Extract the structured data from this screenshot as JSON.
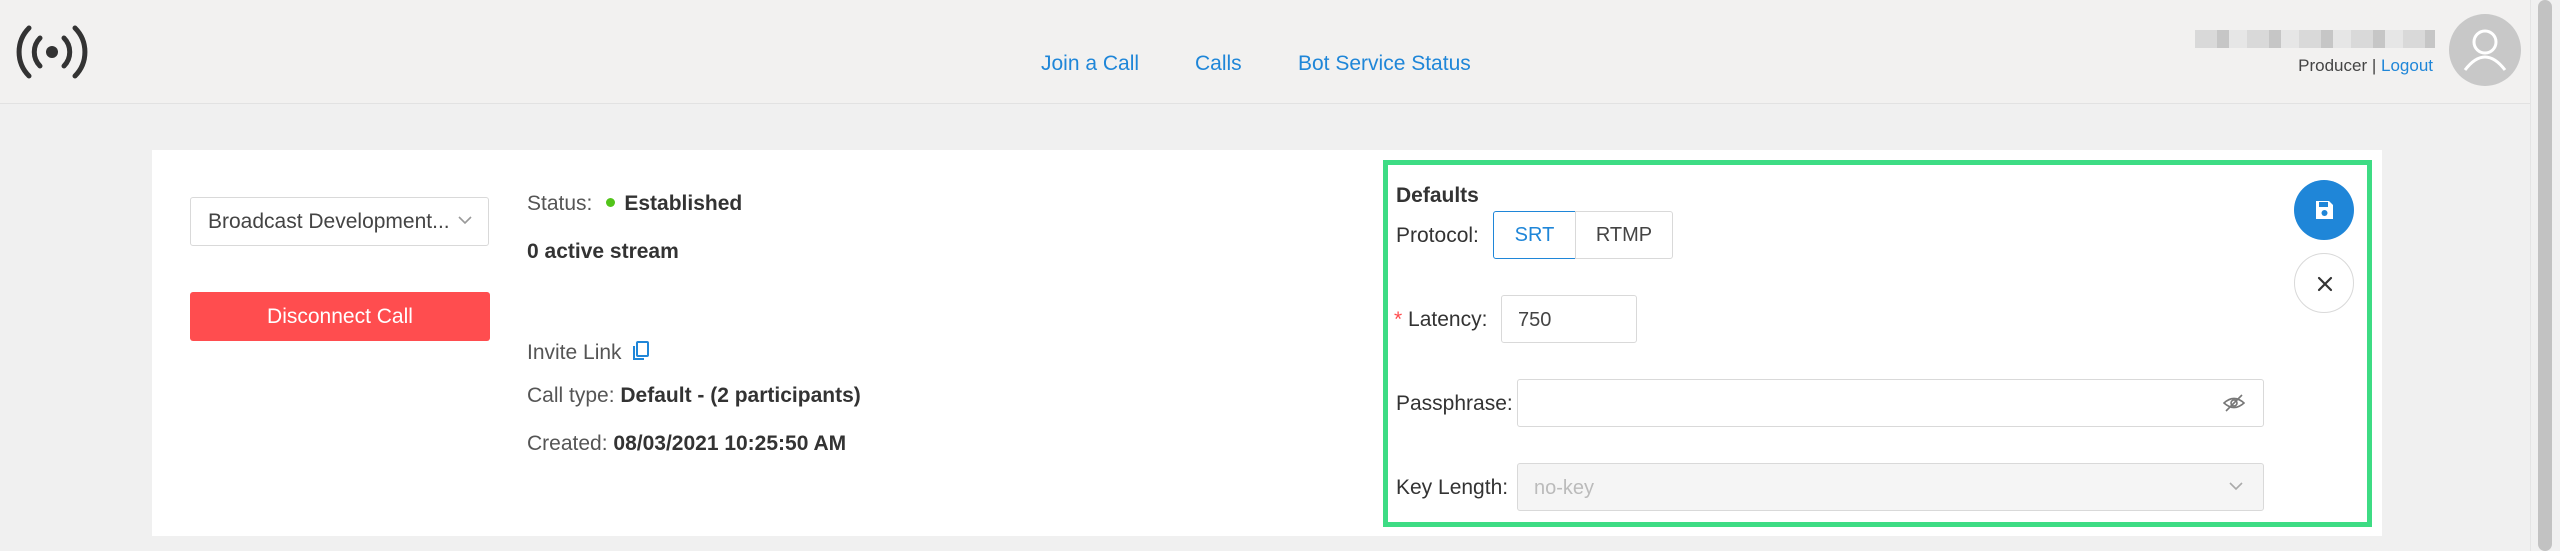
{
  "nav": {
    "join_call": "Join a Call",
    "calls": "Calls",
    "bot_service_status": "Bot Service Status"
  },
  "user": {
    "role": "Producer",
    "separator": "|",
    "logout": "Logout"
  },
  "call": {
    "selected_call": "Broadcast Development...",
    "disconnect_label": "Disconnect Call",
    "status_label": "Status:",
    "status_value": "Established",
    "active_streams": "0 active stream",
    "invite_link_label": "Invite Link",
    "call_type_label": "Call type:",
    "call_type_value": "Default - (2 participants)",
    "created_label": "Created:",
    "created_value": "08/03/2021 10:25:50 AM"
  },
  "defaults": {
    "heading": "Defaults",
    "protocol_label": "Protocol",
    "protocol_options": [
      "SRT",
      "RTMP"
    ],
    "protocol_selected": "SRT",
    "latency_label": "Latency",
    "latency_value": "750",
    "passphrase_label": "Passphrase",
    "passphrase_value": "",
    "key_length_label": "Key Length",
    "key_length_value": "no-key"
  },
  "colors": {
    "accent": "#1f86d8",
    "danger": "#ff4d4f",
    "success": "#52c41a",
    "highlight": "#3ddc84"
  },
  "icons": {
    "logo": "broadcast-icon",
    "avatar": "user-icon",
    "invite": "copy-icon",
    "passphrase_toggle": "eye-invisible-icon",
    "select_arrow": "chevron-down-icon",
    "save": "save-icon",
    "close": "close-icon"
  }
}
